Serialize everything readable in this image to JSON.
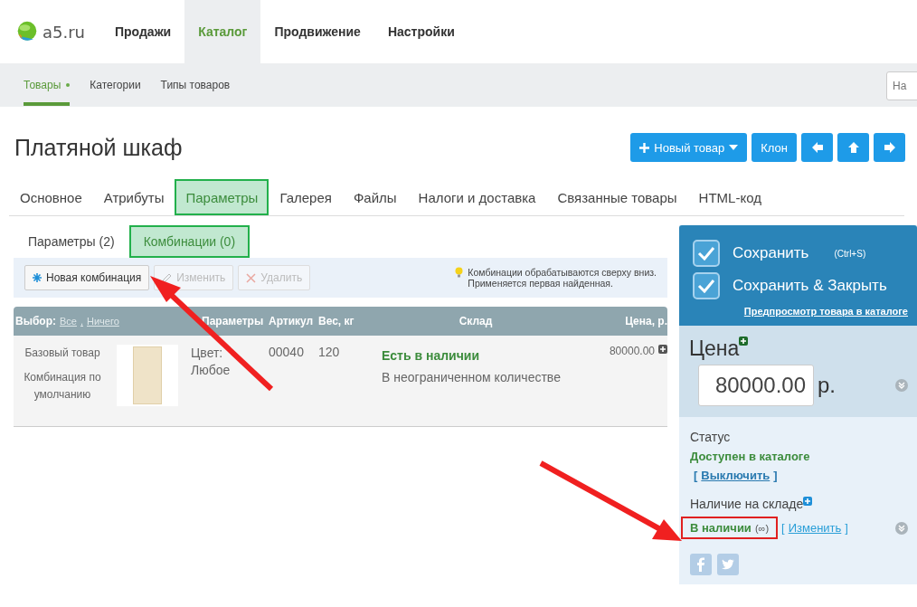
{
  "logo": {
    "text": "a5.ru"
  },
  "main_nav": [
    {
      "label": "Продажи",
      "selected": false
    },
    {
      "label": "Каталог",
      "selected": true
    },
    {
      "label": "Продвижение",
      "selected": false
    },
    {
      "label": "Настройки",
      "selected": false
    }
  ],
  "sub_nav": [
    {
      "label": "Товары",
      "selected": true
    },
    {
      "label": "Категории",
      "selected": false
    },
    {
      "label": "Типы товаров",
      "selected": false
    }
  ],
  "search": {
    "placeholder": "На"
  },
  "page_title": "Платяной шкаф",
  "toolbar": {
    "new_button": "Новый товар",
    "clone_button": "Клон"
  },
  "tabs": [
    {
      "label": "Основное",
      "selected": false
    },
    {
      "label": "Атрибуты",
      "selected": false
    },
    {
      "label": "Параметры",
      "selected": true
    },
    {
      "label": "Галерея",
      "selected": false
    },
    {
      "label": "Файлы",
      "selected": false
    },
    {
      "label": "Налоги и доставка",
      "selected": false
    },
    {
      "label": "Связанные товары",
      "selected": false
    },
    {
      "label": "HTML-код",
      "selected": false
    }
  ],
  "subtabs": [
    {
      "label": "Параметры (2)",
      "selected": false
    },
    {
      "label": "Комбинации (0)",
      "selected": true
    }
  ],
  "actions": [
    {
      "kind": "new",
      "label": "Новая комбинация",
      "disabled": false
    },
    {
      "kind": "edit",
      "label": "Изменить",
      "disabled": true
    },
    {
      "kind": "delete",
      "label": "Удалить",
      "disabled": true
    }
  ],
  "hint": {
    "lines": [
      "Комбинации обрабатываются сверху вниз.",
      "Применяется первая найденная."
    ]
  },
  "table": {
    "select_label": "Выбор:",
    "select_all": "Все",
    "select_sep": ",",
    "select_none": "Ничего",
    "columns": [
      "Параметры",
      "Артикул",
      "Вес, кг",
      "Склад",
      "Цена, р."
    ],
    "row": {
      "base_label": "Базовый товар",
      "default_label": "Комбинация по умолчанию",
      "params": "Цвет: Любое",
      "sku": "00040",
      "weight": "120",
      "stock_status": "Есть в наличии",
      "stock_note": "В неограниченном количестве",
      "price": "80000.00"
    }
  },
  "side": {
    "save": "Сохранить",
    "shortcut": "(Ctrl+S)",
    "save_close": "Сохранить & Закрыть",
    "preview_link": "Предпросмотр товара в каталоге",
    "price_label": "Цена",
    "price_value": "80000.00",
    "currency": "р.",
    "status_label": "Статус",
    "status_value": "Доступен в каталоге",
    "status_open": "[",
    "status_toggle": "Выключить",
    "status_close": "]",
    "stock_label": "Наличие на складе",
    "stock_value": "В наличии",
    "stock_qty": "(∞)",
    "stock_open": "[",
    "stock_change": "Изменить",
    "stock_close": "]"
  }
}
